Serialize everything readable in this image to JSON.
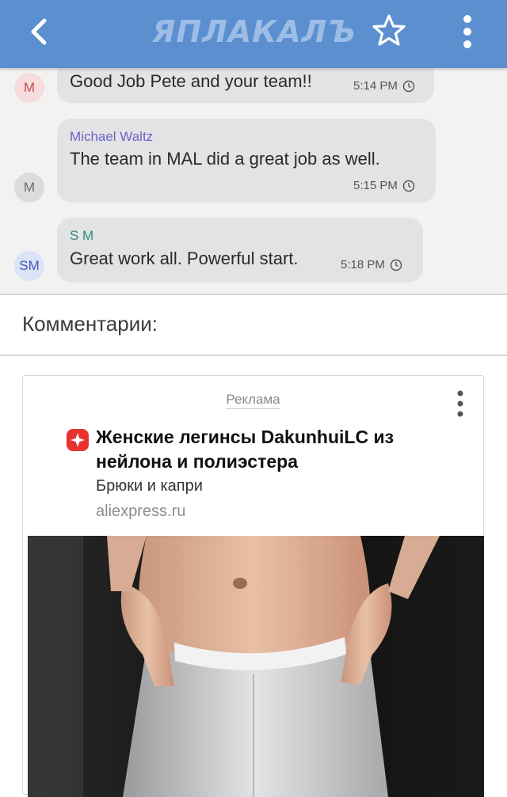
{
  "header": {
    "logo_text": "ЯПЛАКАЛЪ",
    "back_icon": "chevron-left-icon",
    "star_icon": "star-outline-icon",
    "menu_icon": "vertical-dots-icon",
    "bg_color": "#5b8fd0"
  },
  "chat": {
    "messages": [
      {
        "avatar": "M",
        "sender": "",
        "text": "Good Job Pete and your team!!",
        "time": "5:14 PM"
      },
      {
        "avatar": "M",
        "sender": "Michael Waltz",
        "text": "The team in MAL did a great job  as well.",
        "time": "5:15 PM"
      },
      {
        "avatar": "SM",
        "sender": "S M",
        "text": "Great work all. Powerful start.",
        "time": "5:18 PM"
      }
    ]
  },
  "comments": {
    "title": "Комментарии:"
  },
  "ad": {
    "label": "Реклама",
    "title": "Женские легинсы DakunhuiLC из нейлона и полиэстера",
    "subtitle": "Брюки и капри",
    "domain": "aliexpress.ru",
    "brand_color": "#e8322e"
  }
}
